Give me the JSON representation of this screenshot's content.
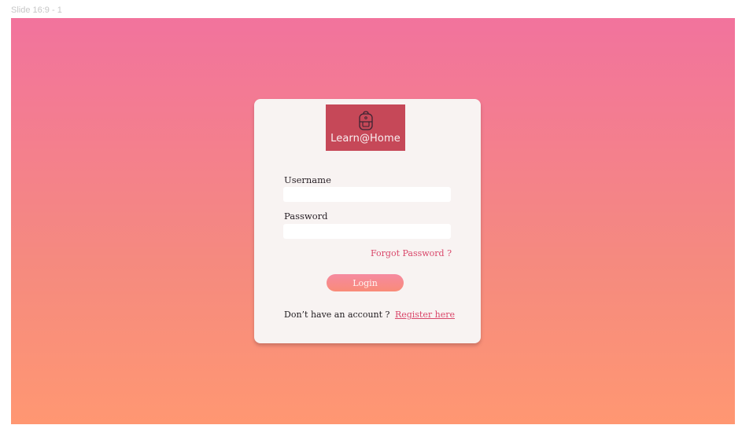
{
  "frame": {
    "label": "Slide 16:9 - 1"
  },
  "logo": {
    "icon": "backpack-icon",
    "brand_text": "Learn@Home"
  },
  "form": {
    "username_label": "Username",
    "username_value": "",
    "password_label": "Password",
    "password_value": "",
    "forgot_link": "Forgot Password ?",
    "login_button": "Login",
    "no_account_text": "Don’t have an account ?",
    "register_link": "Register here"
  },
  "colors": {
    "gradient_top": "#f2739d",
    "gradient_bottom": "#ff9772",
    "card_bg": "#f8f3f2",
    "logo_bg": "#c64858",
    "accent": "#d9476a"
  }
}
